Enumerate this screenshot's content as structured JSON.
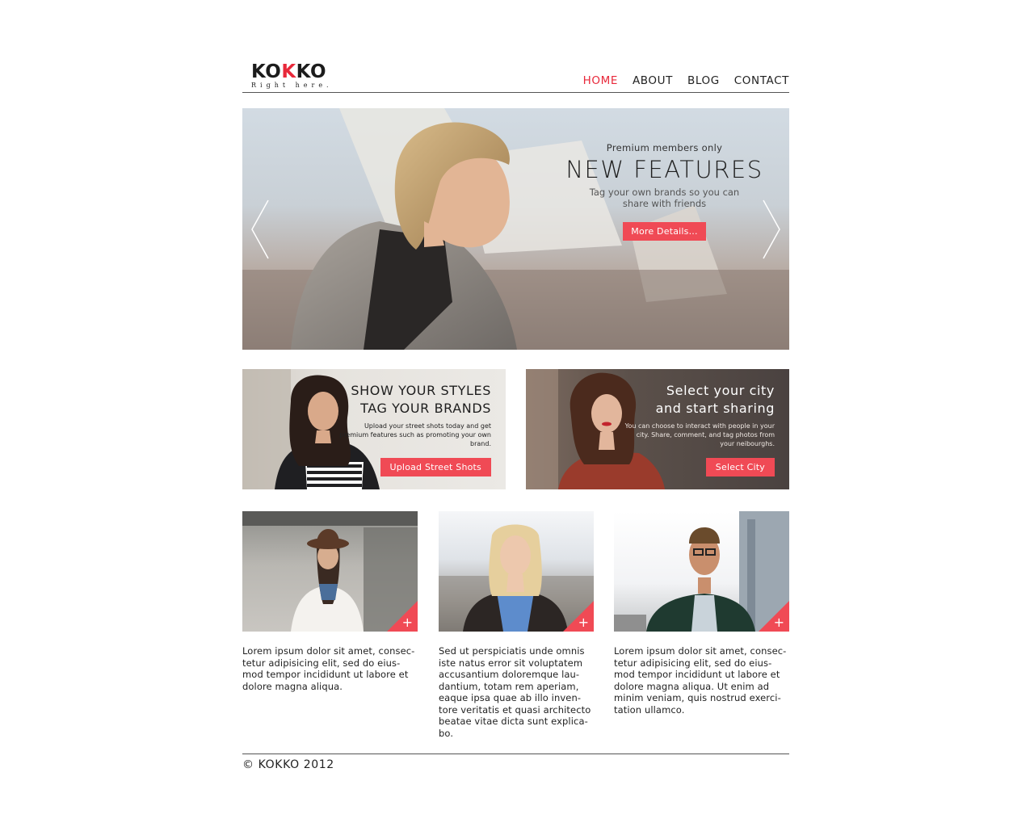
{
  "brand": {
    "logo_text": "KOKKO",
    "tagline": "Right here."
  },
  "nav": {
    "items": [
      {
        "label": "HOME",
        "active": true
      },
      {
        "label": "ABOUT",
        "active": false
      },
      {
        "label": "BLOG",
        "active": false
      },
      {
        "label": "CONTACT",
        "active": false
      }
    ]
  },
  "hero": {
    "kicker": "Premium members only",
    "title": "NEW FEATURES",
    "description": "Tag your own brands so you can share with friends",
    "button_label": "More Details...",
    "prev_icon": "chevron-left-icon",
    "next_icon": "chevron-right-icon"
  },
  "promos": [
    {
      "title_line1": "SHOW YOUR STYLES",
      "title_line2": "TAG YOUR BRANDS",
      "description": "Upload your street shots today and get premium features such as promoting your own brand.",
      "button_label": "Upload Street Shots"
    },
    {
      "title_line1": "Select your city",
      "title_line2": "and start sharing",
      "description": "You can choose to interact with people in your city. Share, comment, and tag photos from your neibourghs.",
      "button_label": "Select City"
    }
  ],
  "cards": [
    {
      "text": "Lorem ipsum dolor sit amet, consec-tetur adipisicing elit, sed do eius-mod tempor incididunt ut labore et dolore magna aliqua.",
      "plus": "+"
    },
    {
      "text": "Sed ut perspiciatis unde omnis iste natus error sit voluptatem accusantium doloremque lau-dantium, totam rem aperiam, eaque ipsa quae ab illo inven-tore veritatis et quasi architecto beatae vitae dicta sunt explica-bo.",
      "plus": "+"
    },
    {
      "text": "Lorem ipsum dolor sit amet, consec-tetur adipisicing elit, sed do eius-mod tempor incididunt ut labore et dolore magna aliqua. Ut enim ad minim veniam, quis nostrud exerci-tation ullamco.",
      "plus": "+"
    }
  ],
  "footer": {
    "copyright": "© KOKKO 2012"
  },
  "colors": {
    "accent": "#f04a55",
    "nav_active": "#e8283a",
    "text": "#222222"
  }
}
